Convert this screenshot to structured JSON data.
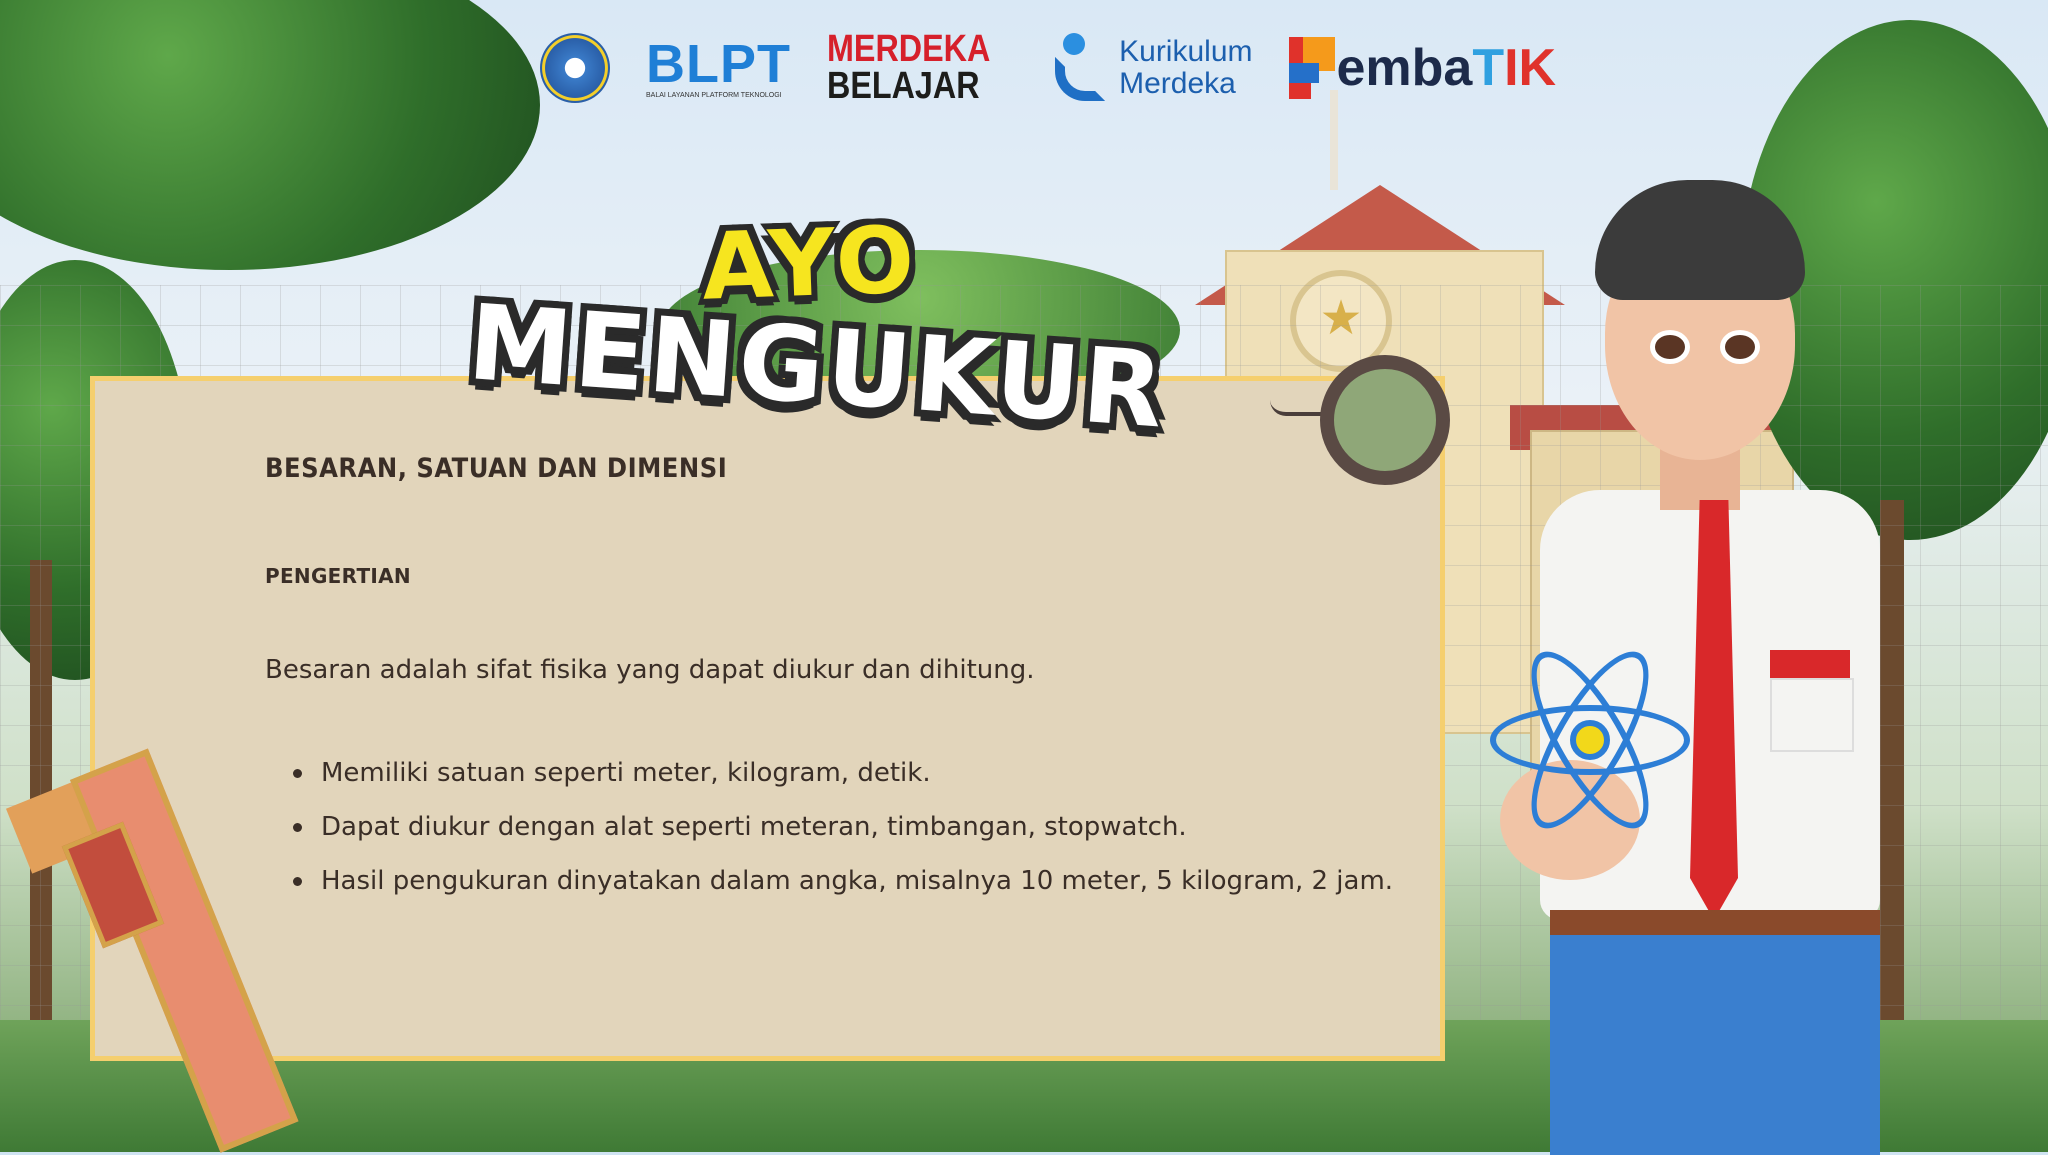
{
  "logos": {
    "blpt": {
      "main": "BLPT",
      "subtitle": "BALAI LAYANAN PLATFORM TEKNOLOGI"
    },
    "merdeka_belajar": {
      "line1": "MERDEKA",
      "line2": "BELAJAR"
    },
    "kurikulum_merdeka": {
      "line1": "Kurikulum",
      "line2": "Merdeka"
    },
    "pembatik": {
      "main": "emba",
      "t": "T",
      "ik": "IK"
    }
  },
  "title": {
    "line1": "AYO",
    "line2": "MENGUKUR"
  },
  "card": {
    "heading": "BESARAN, SATUAN DAN DIMENSI",
    "subheading": "PENGERTIAN",
    "definition": "Besaran adalah sifat fisika yang dapat diukur dan dihitung.",
    "points": [
      "Memiliki satuan seperti meter, kilogram, detik.",
      "Dapat diukur dengan alat seperti meteran, timbangan, stopwatch.",
      "Hasil pengukuran dinyatakan dalam angka, misalnya 10 meter, 5 kilogram, 2 jam."
    ]
  },
  "colors": {
    "card_bg": "#e2d5bb",
    "card_border": "#f5cf6e",
    "text": "#3a2e27",
    "title_yellow": "#f6e51f"
  }
}
